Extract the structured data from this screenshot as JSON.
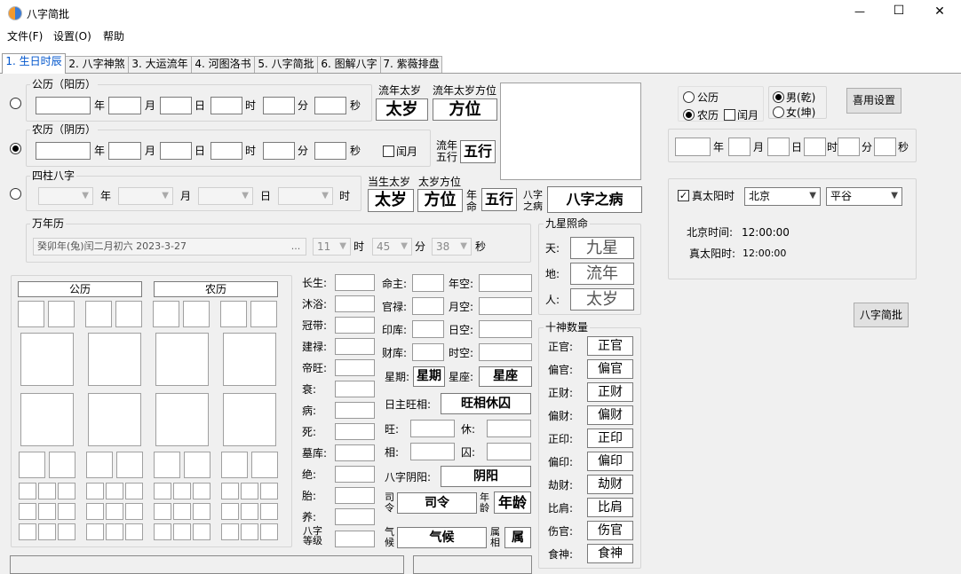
{
  "window": {
    "title": "八字简批",
    "minimize": "—",
    "maximize": "☐",
    "close": "✕"
  },
  "menu": {
    "file": "文件(F)",
    "settings": "设置(O)",
    "help": "帮助"
  },
  "tabs": [
    "1. 生日时辰",
    "2. 八字神煞",
    "3. 大运流年",
    "4. 河图洛书",
    "5. 八字简批",
    "6. 图解八字",
    "7. 紫薇排盘"
  ],
  "solar": {
    "legend": "公历（阳历）",
    "year": "年",
    "month": "月",
    "day": "日",
    "hour": "时",
    "minute": "分",
    "second": "秒"
  },
  "lunar": {
    "legend": "农历（阴历）",
    "year": "年",
    "month": "月",
    "day": "日",
    "hour": "时",
    "minute": "分",
    "second": "秒",
    "leap": "闰月"
  },
  "pillars": {
    "legend": "四柱八字",
    "year": "年",
    "month": "月",
    "day": "日",
    "hour": "时"
  },
  "panel": {
    "liunian_taisui": "流年太岁",
    "liunian_taisui_dir": "流年太岁方位",
    "taisui": "太岁",
    "fangwei": "方位",
    "liunian": "流年",
    "wuxing_lbl": "五行",
    "wuxing": "五行",
    "dangsheng": "当生太岁",
    "taisui_dir": "太岁方位",
    "taisui2": "太岁",
    "fangwei2": "方位",
    "nian": "年",
    "ming": "命",
    "wuxing2": "五行",
    "bazi": "八字",
    "zhibing": "之病",
    "bazi_zhibing": "八字之病"
  },
  "wannian": {
    "legend": "万年历",
    "value": "癸卯年(兔)闰二月初六  2023-3-27",
    "more": "...",
    "hour_val": "11",
    "hour": "时",
    "minute_val": "45",
    "minute": "分",
    "second_val": "38",
    "second": "秒"
  },
  "jiuxing": {
    "legend": "九星照命",
    "tian": "天:",
    "di": "地:",
    "ren": "人:",
    "jiuxing": "九星",
    "liunian": "流年",
    "taisui": "太岁"
  },
  "grid": {
    "solar": "公历",
    "lunar": "农历"
  },
  "lifestage": [
    "长生:",
    "沐浴:",
    "冠带:",
    "建禄:",
    "帝旺:",
    "衰:",
    "病:",
    "死:",
    "墓库:",
    "绝:",
    "胎:",
    "养:"
  ],
  "bazi_level": {
    "l1": "八字",
    "l2": "等级"
  },
  "mid": {
    "mingzhu": "命主:",
    "guanlu": "官禄:",
    "yinku": "印库:",
    "caiku": "财库:",
    "niankong": "年空:",
    "yuekong": "月空:",
    "rikong": "日空:",
    "shikong": "时空:",
    "xingqi_lbl": "星期:",
    "xingqi": "星期",
    "xingzuo_lbl": "星座:",
    "xingzuo": "星座",
    "wangxiang_lbl": "日主旺相:",
    "wangxiang": "旺相休囚",
    "wang": "旺:",
    "xiu": "休:",
    "xiang": "相:",
    "qiu": "囚:",
    "yinyang_lbl": "八字阴阳:",
    "yinyang": "阴阳",
    "si": "司",
    "ling": "令",
    "siling": "司令",
    "nian": "年",
    "ling2": "龄",
    "nianling": "年龄",
    "qi": "气",
    "hou": "候",
    "qihou": "气候",
    "shu1": "属",
    "xiang2": "相",
    "shu": "属"
  },
  "shishen": {
    "legend": "十神数量",
    "items": [
      {
        "label": "正官:",
        "value": "正官"
      },
      {
        "label": "偏官:",
        "value": "偏官"
      },
      {
        "label": "正财:",
        "value": "正财"
      },
      {
        "label": "偏财:",
        "value": "偏财"
      },
      {
        "label": "正印:",
        "value": "正印"
      },
      {
        "label": "偏印:",
        "value": "偏印"
      },
      {
        "label": "劫财:",
        "value": "劫财"
      },
      {
        "label": "比肩:",
        "value": "比肩"
      },
      {
        "label": "伤官:",
        "value": "伤官"
      },
      {
        "label": "食神:",
        "value": "食神"
      }
    ]
  },
  "right": {
    "solar": "公历",
    "lunar": "农历",
    "leap": "闰月",
    "male": "男(乾)",
    "female": "女(坤)",
    "xiyong": "喜用设置",
    "year": "年",
    "month": "月",
    "day": "日",
    "hour": "时",
    "minute": "分",
    "second": "秒",
    "true_solar": "真太阳时",
    "city": "北京",
    "district": "平谷",
    "bj_label": "北京时间:",
    "bj_value": "12:00:00",
    "ts_label": "真太阳时:",
    "ts_value": "12:00:00",
    "jianpi": "八字简批"
  },
  "colors": {
    "accent": "#0055cc",
    "logo_blue": "#3a7bd5",
    "logo_orange": "#f2992e"
  }
}
